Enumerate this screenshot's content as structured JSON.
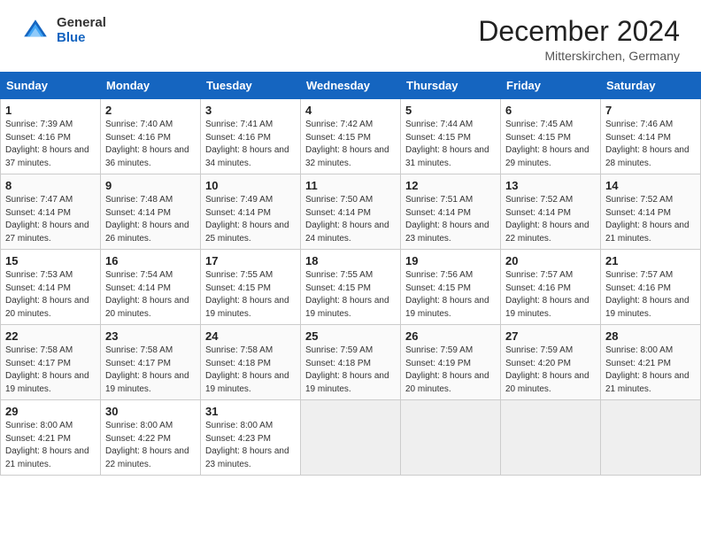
{
  "header": {
    "logo_general": "General",
    "logo_blue": "Blue",
    "month_title": "December 2024",
    "location": "Mitterskirchen, Germany"
  },
  "days_of_week": [
    "Sunday",
    "Monday",
    "Tuesday",
    "Wednesday",
    "Thursday",
    "Friday",
    "Saturday"
  ],
  "weeks": [
    [
      {
        "day": 1,
        "sunrise": "7:39 AM",
        "sunset": "4:16 PM",
        "daylight": "8 hours and 37 minutes."
      },
      {
        "day": 2,
        "sunrise": "7:40 AM",
        "sunset": "4:16 PM",
        "daylight": "8 hours and 36 minutes."
      },
      {
        "day": 3,
        "sunrise": "7:41 AM",
        "sunset": "4:16 PM",
        "daylight": "8 hours and 34 minutes."
      },
      {
        "day": 4,
        "sunrise": "7:42 AM",
        "sunset": "4:15 PM",
        "daylight": "8 hours and 32 minutes."
      },
      {
        "day": 5,
        "sunrise": "7:44 AM",
        "sunset": "4:15 PM",
        "daylight": "8 hours and 31 minutes."
      },
      {
        "day": 6,
        "sunrise": "7:45 AM",
        "sunset": "4:15 PM",
        "daylight": "8 hours and 29 minutes."
      },
      {
        "day": 7,
        "sunrise": "7:46 AM",
        "sunset": "4:14 PM",
        "daylight": "8 hours and 28 minutes."
      }
    ],
    [
      {
        "day": 8,
        "sunrise": "7:47 AM",
        "sunset": "4:14 PM",
        "daylight": "8 hours and 27 minutes."
      },
      {
        "day": 9,
        "sunrise": "7:48 AM",
        "sunset": "4:14 PM",
        "daylight": "8 hours and 26 minutes."
      },
      {
        "day": 10,
        "sunrise": "7:49 AM",
        "sunset": "4:14 PM",
        "daylight": "8 hours and 25 minutes."
      },
      {
        "day": 11,
        "sunrise": "7:50 AM",
        "sunset": "4:14 PM",
        "daylight": "8 hours and 24 minutes."
      },
      {
        "day": 12,
        "sunrise": "7:51 AM",
        "sunset": "4:14 PM",
        "daylight": "8 hours and 23 minutes."
      },
      {
        "day": 13,
        "sunrise": "7:52 AM",
        "sunset": "4:14 PM",
        "daylight": "8 hours and 22 minutes."
      },
      {
        "day": 14,
        "sunrise": "7:52 AM",
        "sunset": "4:14 PM",
        "daylight": "8 hours and 21 minutes."
      }
    ],
    [
      {
        "day": 15,
        "sunrise": "7:53 AM",
        "sunset": "4:14 PM",
        "daylight": "8 hours and 20 minutes."
      },
      {
        "day": 16,
        "sunrise": "7:54 AM",
        "sunset": "4:14 PM",
        "daylight": "8 hours and 20 minutes."
      },
      {
        "day": 17,
        "sunrise": "7:55 AM",
        "sunset": "4:15 PM",
        "daylight": "8 hours and 19 minutes."
      },
      {
        "day": 18,
        "sunrise": "7:55 AM",
        "sunset": "4:15 PM",
        "daylight": "8 hours and 19 minutes."
      },
      {
        "day": 19,
        "sunrise": "7:56 AM",
        "sunset": "4:15 PM",
        "daylight": "8 hours and 19 minutes."
      },
      {
        "day": 20,
        "sunrise": "7:57 AM",
        "sunset": "4:16 PM",
        "daylight": "8 hours and 19 minutes."
      },
      {
        "day": 21,
        "sunrise": "7:57 AM",
        "sunset": "4:16 PM",
        "daylight": "8 hours and 19 minutes."
      }
    ],
    [
      {
        "day": 22,
        "sunrise": "7:58 AM",
        "sunset": "4:17 PM",
        "daylight": "8 hours and 19 minutes."
      },
      {
        "day": 23,
        "sunrise": "7:58 AM",
        "sunset": "4:17 PM",
        "daylight": "8 hours and 19 minutes."
      },
      {
        "day": 24,
        "sunrise": "7:58 AM",
        "sunset": "4:18 PM",
        "daylight": "8 hours and 19 minutes."
      },
      {
        "day": 25,
        "sunrise": "7:59 AM",
        "sunset": "4:18 PM",
        "daylight": "8 hours and 19 minutes."
      },
      {
        "day": 26,
        "sunrise": "7:59 AM",
        "sunset": "4:19 PM",
        "daylight": "8 hours and 20 minutes."
      },
      {
        "day": 27,
        "sunrise": "7:59 AM",
        "sunset": "4:20 PM",
        "daylight": "8 hours and 20 minutes."
      },
      {
        "day": 28,
        "sunrise": "8:00 AM",
        "sunset": "4:21 PM",
        "daylight": "8 hours and 21 minutes."
      }
    ],
    [
      {
        "day": 29,
        "sunrise": "8:00 AM",
        "sunset": "4:21 PM",
        "daylight": "8 hours and 21 minutes."
      },
      {
        "day": 30,
        "sunrise": "8:00 AM",
        "sunset": "4:22 PM",
        "daylight": "8 hours and 22 minutes."
      },
      {
        "day": 31,
        "sunrise": "8:00 AM",
        "sunset": "4:23 PM",
        "daylight": "8 hours and 23 minutes."
      },
      null,
      null,
      null,
      null
    ]
  ],
  "labels": {
    "sunrise": "Sunrise:",
    "sunset": "Sunset:",
    "daylight": "Daylight:"
  }
}
